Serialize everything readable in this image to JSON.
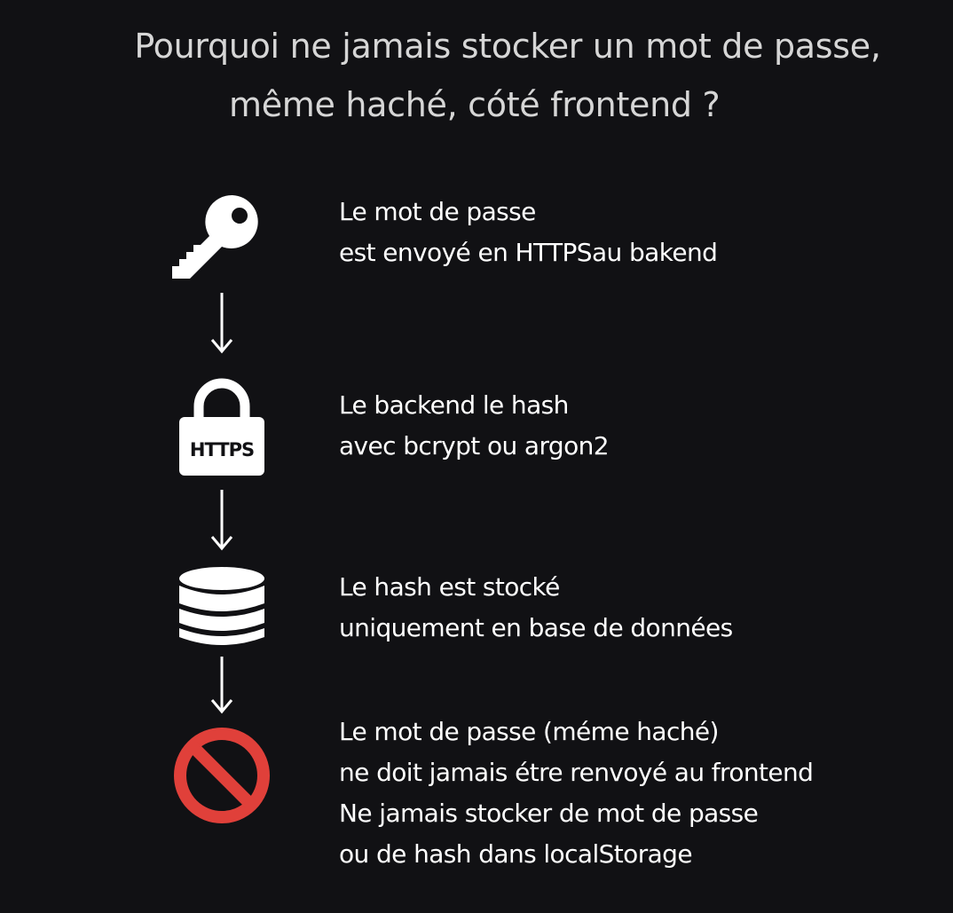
{
  "title": {
    "line1": "Pourquoi ne jamais stocker un mot de passe,",
    "line2": "même haché, cóté frontend ?"
  },
  "steps": [
    {
      "icon": "key-icon",
      "lines": [
        "Le mot de passe",
        "est envoyé en HTTPSau bakend"
      ]
    },
    {
      "icon": "padlock-icon",
      "icon_label": "HTTPS",
      "lines": [
        "Le backend le hash",
        "avec bcrypt ou argon2"
      ]
    },
    {
      "icon": "database-icon",
      "lines": [
        "Le hash est stocké",
        "uniquement en base de données"
      ]
    },
    {
      "icon": "prohibited-icon",
      "icon_color": "#e0403a",
      "lines": [
        "Le mot de passe (méme haché)",
        "ne doit jamais étre renvoyé au frontend",
        "Ne jamais stocker de mot de passe",
        "ou de hash dans localStorage"
      ]
    }
  ],
  "colors": {
    "background": "#111114",
    "title": "#d6d6d6",
    "text": "#ffffff",
    "danger": "#e0403a"
  }
}
